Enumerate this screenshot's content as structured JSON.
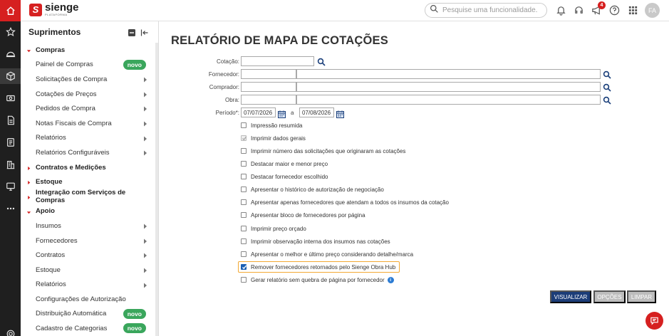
{
  "brand": {
    "name": "sienge",
    "sub": "PLATAFORMA"
  },
  "search": {
    "placeholder": "Pesquise uma funcionalidade."
  },
  "topbar": {
    "notifications_count": "4",
    "avatar": "FA"
  },
  "sidebar": {
    "title": "Suprimentos",
    "items": [
      {
        "label": "Compras",
        "kind": "cat",
        "expanded": true
      },
      {
        "label": "Painel de Compras",
        "kind": "sub",
        "badge": "novo"
      },
      {
        "label": "Solicitações de Compra",
        "kind": "sub",
        "arrow": true
      },
      {
        "label": "Cotações de Preços",
        "kind": "sub",
        "arrow": true
      },
      {
        "label": "Pedidos de Compra",
        "kind": "sub",
        "arrow": true
      },
      {
        "label": "Notas Fiscais de Compra",
        "kind": "sub",
        "arrow": true
      },
      {
        "label": "Relatórios",
        "kind": "sub",
        "arrow": true
      },
      {
        "label": "Relatórios Configuráveis",
        "kind": "sub",
        "arrow": true
      },
      {
        "label": "Contratos e Medições",
        "kind": "cat",
        "expanded": false
      },
      {
        "label": "Estoque",
        "kind": "cat",
        "expanded": false
      },
      {
        "label": "Integração com Serviços de Compras",
        "kind": "cat",
        "expanded": false
      },
      {
        "label": "Apoio",
        "kind": "cat",
        "expanded": true
      },
      {
        "label": "Insumos",
        "kind": "sub",
        "arrow": true
      },
      {
        "label": "Fornecedores",
        "kind": "sub",
        "arrow": true
      },
      {
        "label": "Contratos",
        "kind": "sub",
        "arrow": true
      },
      {
        "label": "Estoque",
        "kind": "sub",
        "arrow": true
      },
      {
        "label": "Relatórios",
        "kind": "sub",
        "arrow": true
      },
      {
        "label": "Configurações de Autorização",
        "kind": "sub"
      },
      {
        "label": "Distribuição Automática",
        "kind": "sub",
        "badge": "novo"
      },
      {
        "label": "Cadastro de Categorias",
        "kind": "sub",
        "badge": "novo"
      }
    ]
  },
  "main": {
    "title": "RELATÓRIO DE MAPA DE COTAÇÕES",
    "labels": {
      "cotacao": "Cotação:",
      "fornecedor": "Fornecedor:",
      "comprador": "Comprador:",
      "obra": "Obra:",
      "periodo": "Período*:",
      "between": "a"
    },
    "fields": {
      "cotacao": "",
      "fornecedor_code": "",
      "fornecedor_name": "",
      "comprador_code": "",
      "comprador_name": "",
      "obra_code": "",
      "obra_name": "",
      "periodo_inicio": "07/07/2026",
      "periodo_fim": "07/08/2026"
    },
    "options": [
      {
        "label": "Impressão resumida",
        "checked": false,
        "disabled": false
      },
      {
        "label": "Imprimir dados gerais",
        "checked": true,
        "disabled": true
      },
      {
        "label": "Imprimir número das solicitações que originaram as cotações",
        "checked": false,
        "disabled": false
      },
      {
        "label": "Destacar maior e menor preço",
        "checked": false,
        "disabled": false
      },
      {
        "label": "Destacar fornecedor escolhido",
        "checked": false,
        "disabled": false
      },
      {
        "label": "Apresentar o histórico de autorização de negociação",
        "checked": false,
        "disabled": false
      },
      {
        "label": "Apresentar apenas fornecedores que atendam a todos os insumos da cotação",
        "checked": false,
        "disabled": false
      },
      {
        "label": "Apresentar bloco de fornecedores por página",
        "checked": false,
        "disabled": false
      },
      {
        "label": "Imprimir preço orçado",
        "checked": false,
        "disabled": false
      },
      {
        "label": "Imprimir observação interna dos insumos nas cotações",
        "checked": false,
        "disabled": false
      },
      {
        "label": "Apresentar o melhor e último preço considerando detalhe/marca",
        "checked": false,
        "disabled": false
      },
      {
        "label": "Remover fornecedores retornados pelo Sienge Obra Hub",
        "checked": true,
        "disabled": false,
        "highlight": true
      },
      {
        "label": "Gerar relatório sem quebra de página por fornecedor",
        "checked": false,
        "disabled": false,
        "info": true
      }
    ],
    "buttons": {
      "visualizar": "VISUALIZAR",
      "opcoes": "OPÇÕES",
      "limpar": "LIMPAR"
    }
  },
  "colors": {
    "brand_red": "#d62020",
    "primary_blue": "#1c3d78",
    "badge_green": "#3aa65c",
    "highlight_orange": "#f2a833"
  }
}
